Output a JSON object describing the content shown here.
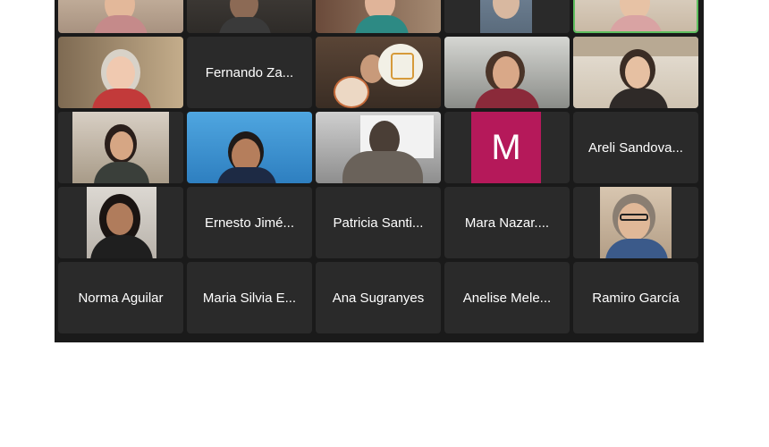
{
  "participants": [
    {
      "name": "Fernando Za..."
    },
    {
      "name": "Areli Sandova..."
    },
    {
      "name": "Ernesto Jimé..."
    },
    {
      "name": "Patricia Santi..."
    },
    {
      "name": "Mara Nazar...."
    },
    {
      "name": "Norma Aguilar"
    },
    {
      "name": "Maria Silvia E..."
    },
    {
      "name": "Ana Sugranyes"
    },
    {
      "name": "Anelise Mele..."
    },
    {
      "name": "Ramiro García"
    }
  ],
  "avatar": {
    "letter": "M",
    "color": "#b5195a"
  },
  "colors": {
    "background": "#1a1a1a",
    "tile": "#2a2a2a",
    "active_speaker_border": "#5fbf5f"
  }
}
